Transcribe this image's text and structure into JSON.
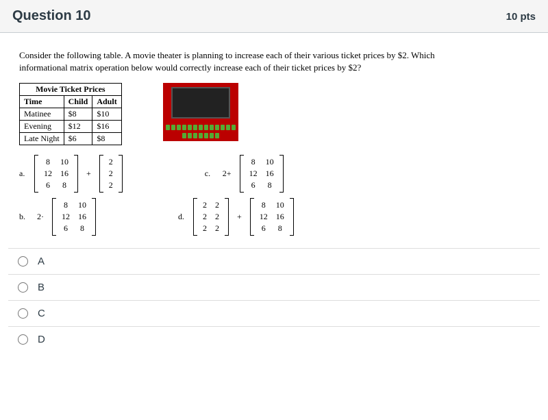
{
  "header": {
    "title": "Question 10",
    "points": "10 pts"
  },
  "prompt": "Consider the following table. A movie theater is planning to increase each of their various ticket prices by $2.  Which informational matrix operation below would correctly increase each of their ticket prices by $2?",
  "table": {
    "title": "Movie Ticket Prices",
    "cols": {
      "c0": "Time",
      "c1": "Child",
      "c2": "Adult"
    },
    "rows": [
      {
        "c0": "Matinee",
        "c1": "$8",
        "c2": "$10"
      },
      {
        "c0": "Evening",
        "c1": "$12",
        "c2": "$16"
      },
      {
        "c0": "Late Night",
        "c1": "$6",
        "c2": "$8"
      }
    ]
  },
  "base_matrix": {
    "r0c0": "8",
    "r0c1": "10",
    "r1c0": "12",
    "r1c1": "16",
    "r2c0": "6",
    "r2c1": "8"
  },
  "vec2": {
    "r0": "2",
    "r1": "2",
    "r2": "2"
  },
  "mat22": {
    "r0c0": "2",
    "r0c1": "2",
    "r1c0": "2",
    "r1c1": "2",
    "r2c0": "2",
    "r2c1": "2"
  },
  "labels": {
    "a": "a.",
    "b": "b.",
    "c": "c.",
    "d": "d."
  },
  "ops": {
    "plus": "+",
    "times2": "2·",
    "plus2": "2+"
  },
  "answers": {
    "a": "A",
    "b": "B",
    "c": "C",
    "d": "D"
  }
}
